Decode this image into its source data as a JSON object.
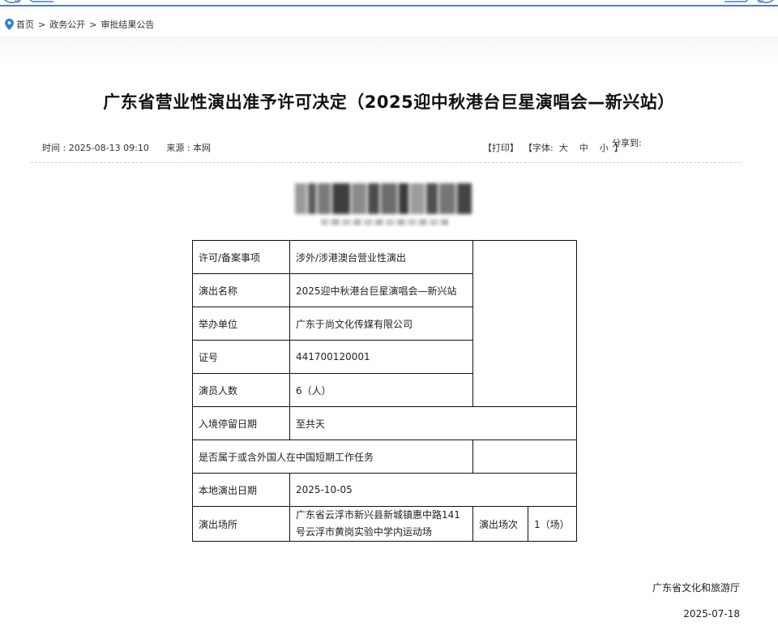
{
  "breadcrumb": [
    "首页",
    "政务公开",
    "审批结果公告"
  ],
  "breadcrumb_sep": ">",
  "title": "广东省营业性演出准予许可决定（2025迎中秋港台巨星演唱会—新兴站）",
  "meta": {
    "time": "时间 : 2025-08-13 09:10",
    "source": "来源 : 本网",
    "print": "【打印】",
    "font_label": "【字体:",
    "font_large": "大",
    "font_medium": "中",
    "font_small": "小",
    "font_close": "】",
    "share": "分享到:"
  },
  "table": {
    "rows": [
      {
        "label": "许可/备案事项",
        "value": "涉外/涉港澳台营业性演出"
      },
      {
        "label": "演出名称",
        "value": "2025迎中秋港台巨星演唱会—新兴站"
      },
      {
        "label": "举办单位",
        "value": "广东于尚文化传媒有限公司"
      },
      {
        "label": "证号",
        "value": "441700120001"
      },
      {
        "label": "演员人数",
        "value": "6（人）"
      },
      {
        "label": "入境停留日期",
        "value": "至共天"
      },
      {
        "label": "是否属于或含外国人在中国短期工作任务",
        "value": ""
      },
      {
        "label": "本地演出日期",
        "value": "2025-10-05"
      }
    ],
    "venue": {
      "label": "演出场所",
      "value": "广东省云浮市新兴县新城镇惠中路141号云浮市黄岗实验中学内运动场",
      "sessions_label": "演出场次",
      "sessions_value": "1（场）"
    }
  },
  "footer": {
    "org": "广东省文化和旅游厅",
    "date": "2025-07-18"
  },
  "colors": {
    "accent": "#4a7ec4",
    "pin": "#2f7fd8",
    "border": "#111111"
  }
}
